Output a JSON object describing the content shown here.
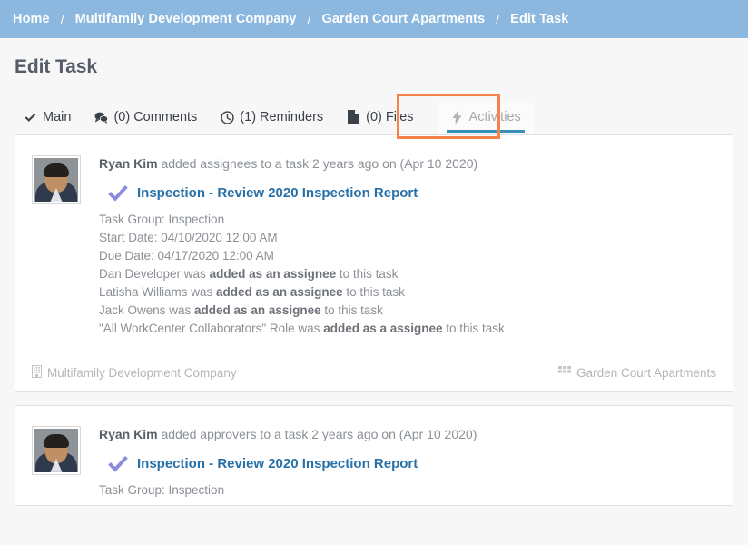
{
  "breadcrumb": {
    "separator": "/",
    "items": [
      {
        "label": "Home",
        "name": "breadcrumb-home"
      },
      {
        "label": "Multifamily Development Company",
        "name": "breadcrumb-company"
      },
      {
        "label": "Garden Court Apartments",
        "name": "breadcrumb-property"
      },
      {
        "label": "Edit Task",
        "name": "breadcrumb-current"
      }
    ]
  },
  "page": {
    "title": "Edit Task"
  },
  "tabs": [
    {
      "label": "Main",
      "icon": "check-icon",
      "active": false
    },
    {
      "label": "(0) Comments",
      "icon": "comments-icon",
      "active": false
    },
    {
      "label": "(1) Reminders",
      "icon": "clock-icon",
      "active": false
    },
    {
      "label": "(0) Files",
      "icon": "file-icon",
      "active": false
    },
    {
      "label": "Activities",
      "icon": "bolt-icon",
      "active": true
    }
  ],
  "colors": {
    "breadcrumb_bar": "#8cb8e0",
    "active_tab_underline": "#3490ba",
    "highlight_box": "#f5824a",
    "task_link": "#2770a8",
    "task_check": "#8b8bdd"
  },
  "activities": [
    {
      "actor": "Ryan Kim",
      "action": " added assignees to a task 2 years ago on (Apr 10 2020)",
      "task_title": "Inspection - Review 2020 Inspection Report",
      "details": [
        {
          "text": "Task Group: Inspection"
        },
        {
          "text": "Start Date: 04/10/2020 12:00 AM"
        },
        {
          "text": "Due Date: 04/17/2020 12:00 AM"
        },
        {
          "pre": "Dan Developer was ",
          "strong": "added as an assignee",
          "post": " to this task"
        },
        {
          "pre": "Latisha Williams was ",
          "strong": "added as an assignee",
          "post": " to this task"
        },
        {
          "pre": "Jack Owens was ",
          "strong": "added as an assignee",
          "post": " to this task"
        },
        {
          "pre": "\"All WorkCenter Collaborators\" Role was ",
          "strong": "added as a assignee",
          "post": " to this task"
        }
      ],
      "footer_left": "Multifamily Development Company",
      "footer_right": "Garden Court Apartments"
    },
    {
      "actor": "Ryan Kim",
      "action": " added approvers to a task 2 years ago on (Apr 10 2020)",
      "task_title": "Inspection - Review 2020 Inspection Report",
      "details": [
        {
          "text": "Task Group: Inspection"
        }
      ],
      "footer_left": "",
      "footer_right": ""
    }
  ]
}
